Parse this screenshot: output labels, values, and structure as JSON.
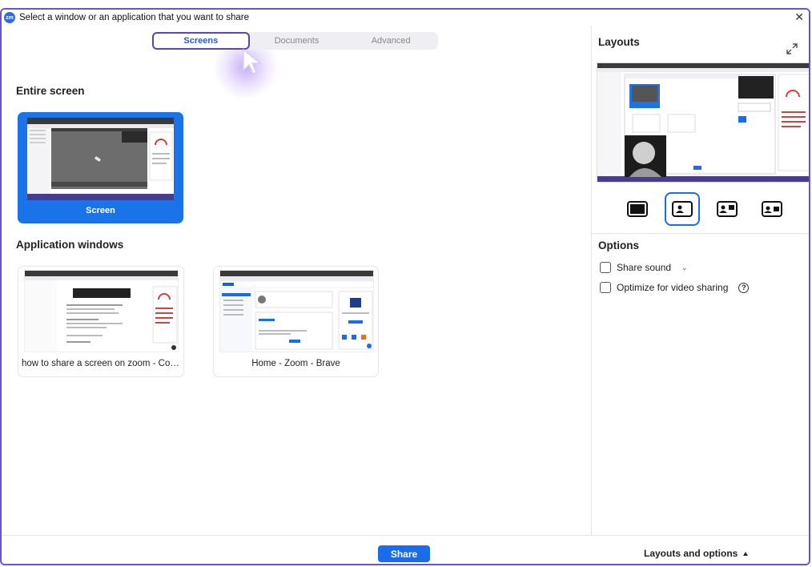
{
  "window": {
    "title": "Select a window or an application that you want to share",
    "app_icon": "zm"
  },
  "tabs": [
    {
      "label": "Screens",
      "active": true
    },
    {
      "label": "Documents",
      "active": false
    },
    {
      "label": "Advanced",
      "active": false
    }
  ],
  "sections": {
    "entire_screen": "Entire screen",
    "application_windows": "Application windows"
  },
  "screens": [
    {
      "label": "Screen",
      "selected": true
    }
  ],
  "applications": [
    {
      "label": "how to share a screen on zoom - Conte..."
    },
    {
      "label": "Home - Zoom - Brave"
    }
  ],
  "right_panel": {
    "layouts_title": "Layouts",
    "options_title": "Options",
    "layouts": [
      {
        "icon": "screen-only-icon",
        "selected": false
      },
      {
        "icon": "speaker-overlay-icon",
        "selected": true
      },
      {
        "icon": "side-by-side-left-icon",
        "selected": false
      },
      {
        "icon": "side-by-side-right-icon",
        "selected": false
      }
    ],
    "options": [
      {
        "label": "Share sound",
        "checked": false
      },
      {
        "label": "Optimize for video sharing",
        "checked": false
      }
    ]
  },
  "footer": {
    "share_label": "Share",
    "layouts_toggle_label": "Layouts and options"
  },
  "colors": {
    "accent": "#1a6dea",
    "tab_outline": "#5d43b6",
    "window_border": "#6a54c9"
  }
}
